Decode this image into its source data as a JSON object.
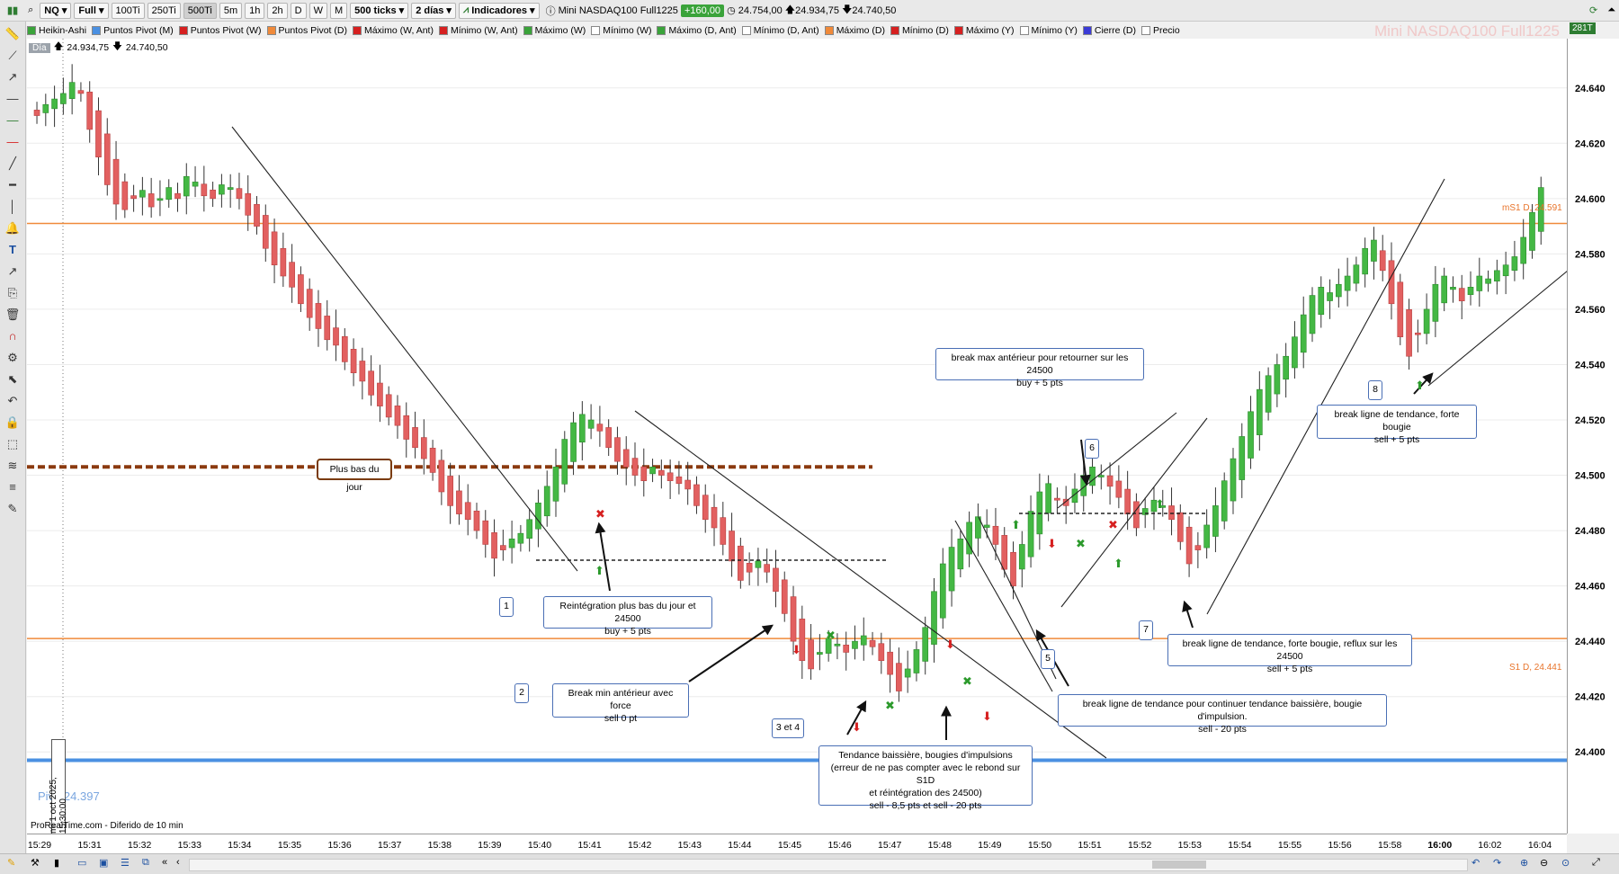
{
  "toolbar": {
    "symbol": "NQ",
    "view": "Full",
    "tf_100": "100Ti",
    "tf_250": "250Ti",
    "tf_500": "500Ti",
    "tf_5m": "5m",
    "tf_1h": "1h",
    "tf_2h": "2h",
    "tf_d": "D",
    "tf_w": "W",
    "tf_m": "M",
    "ticks": "500 ticks",
    "period": "2 días",
    "indicators": "Indicadores",
    "instrument": "Mini NASDAQ100 Full1225",
    "change": "+160,00",
    "last": "24.754,00",
    "high": "24.934,75",
    "low": "24.740,50"
  },
  "legend": {
    "items": [
      {
        "label": "Heikin-Ashi",
        "color": "#3aa33a"
      },
      {
        "label": "Puntos Pivot (M)",
        "color": "#4a90e2"
      },
      {
        "label": "Puntos Pivot (W)",
        "color": "#d62020"
      },
      {
        "label": "Puntos Pivot (D)",
        "color": "#f08a3a"
      },
      {
        "label": "Máximo (W, Ant)",
        "color": "#d62020"
      },
      {
        "label": "Mínimo (W, Ant)",
        "color": "#d62020"
      },
      {
        "label": "Máximo (W)",
        "color": "#3aa33a"
      },
      {
        "label": "Mínimo (W)",
        "color": "#ffffff"
      },
      {
        "label": "Máximo (D, Ant)",
        "color": "#3aa33a"
      },
      {
        "label": "Mínimo (D, Ant)",
        "color": "#ffffff"
      },
      {
        "label": "Máximo (D)",
        "color": "#f08a3a"
      },
      {
        "label": "Mínimo (D)",
        "color": "#d62020"
      },
      {
        "label": "Máximo (Y)",
        "color": "#d62020"
      },
      {
        "label": "Mínimo (Y)",
        "color": "#ffffff"
      },
      {
        "label": "Cierre (D)",
        "color": "#3b3bd6"
      },
      {
        "label": "Precio",
        "color": "#ffffff"
      }
    ]
  },
  "header": {
    "day_badge": "Día",
    "day_high": "24.934,75",
    "day_low": "24.740,50"
  },
  "watermark": "Mini NASDAQ100 Full1225",
  "tick_badge": "281T",
  "footer": {
    "source": "ProRealTime.com - Diferido de 10 min",
    "date_marker": "mi 1 oct 2025, 15:30:00"
  },
  "levels": {
    "ms1_label": "mS1 D, 24.591",
    "s1_label": "S1 D, 24.441",
    "piv_label": "Piv",
    "piv_value": "24.397"
  },
  "annotations": {
    "plus_bas": "Plus bas du jour",
    "a1_line1": "Reintégration plus bas du jour et 24500",
    "a1_line2": "buy + 5 pts",
    "a2_line1": "Break min antérieur avec force",
    "a2_line2": "sell 0 pt",
    "a34_line1": "Tendance baissière, bougies d'impulsions",
    "a34_line2": "(erreur de ne pas compter avec le rebond sur S1D",
    "a34_line3": "et réintégration des 24500)",
    "a34_line4": "sell - 8,5 pts et sell - 20 pts",
    "a5_line1": "break ligne de tendance pour continuer tendance baissière, bougie d'impulsion.",
    "a5_line2": "sell - 20 pts",
    "a6_line1": "break max antérieur pour retourner sur les 24500",
    "a6_line2": "buy + 5 pts",
    "a7_line1": "break ligne de tendance, forte bougie, reflux sur les 24500",
    "a7_line2": "sell + 5 pts",
    "a8_line1": "break ligne de tendance, forte bougie",
    "a8_line2": "sell + 5 pts",
    "n1": "1",
    "n2": "2",
    "n34": "3 et 4",
    "n5": "5",
    "n6": "6",
    "n7": "7",
    "n8": "8"
  },
  "chart_data": {
    "type": "candlestick",
    "style": "Heikin-Ashi",
    "ylim": [
      24390,
      24650
    ],
    "y_ticks": [
      "24.640",
      "24.620",
      "24.600",
      "24.580",
      "24.560",
      "24.540",
      "24.520",
      "24.500",
      "24.480",
      "24.460",
      "24.440",
      "24.420",
      "24.400"
    ],
    "x_ticks": [
      "15:29",
      "15:31",
      "15:32",
      "15:33",
      "15:34",
      "15:35",
      "15:36",
      "15:37",
      "15:38",
      "15:39",
      "15:40",
      "15:41",
      "15:42",
      "15:43",
      "15:44",
      "15:45",
      "15:46",
      "15:47",
      "15:48",
      "15:49",
      "15:50",
      "15:51",
      "15:52",
      "15:53",
      "15:54",
      "15:55",
      "15:56",
      "15:58",
      "16:00",
      "16:02",
      "16:04"
    ],
    "levels": [
      {
        "name": "mS1 D",
        "value": 24591,
        "color": "#f08a3a"
      },
      {
        "name": "S1 D",
        "value": 24441,
        "color": "#f08a3a"
      },
      {
        "name": "Piv",
        "value": 24397,
        "color": "#4a90e2"
      },
      {
        "name": "Plus bas du jour",
        "value": 24503,
        "color": "#8b3a0f"
      }
    ],
    "closes": [
      24630,
      24634,
      24636,
      24638,
      24642,
      24638,
      24625,
      24615,
      24605,
      24598,
      24596,
      24600,
      24603,
      24597,
      24600,
      24604,
      24600,
      24608,
      24606,
      24601,
      24600,
      24605,
      24604,
      24600,
      24594,
      24590,
      24582,
      24576,
      24572,
      24568,
      24562,
      24557,
      24553,
      24549,
      24547,
      24541,
      24537,
      24534,
      24529,
      24525,
      24521,
      24518,
      24513,
      24510,
      24506,
      24501,
      24494,
      24489,
      24486,
      24484,
      24480,
      24475,
      24470,
      24473,
      24477,
      24479,
      24484,
      24490,
      24496,
      24503,
      24513,
      24519,
      24522,
      24520,
      24516,
      24510,
      24505,
      24503,
      24500,
      24498,
      24503,
      24500,
      24498,
      24497,
      24495,
      24489,
      24484,
      24481,
      24475,
      24469,
      24462,
      24465,
      24469,
      24465,
      24458,
      24450,
      24440,
      24433,
      24430,
      24436,
      24441,
      24439,
      24436,
      24440,
      24442,
      24438,
      24433,
      24428,
      24422,
      24430,
      24437,
      24445,
      24458,
      24468,
      24474,
      24477,
      24483,
      24485,
      24482,
      24475,
      24466,
      24460,
      24475,
      24487,
      24494,
      24497,
      24491,
      24489,
      24495,
      24500,
      24503,
      24500,
      24496,
      24492,
      24486,
      24481,
      24488,
      24491,
      24489,
      24484,
      24476,
      24468,
      24473,
      24482,
      24489,
      24498,
      24506,
      24514,
      24523,
      24531,
      24536,
      24540,
      24543,
      24550,
      24558,
      24565,
      24568,
      24566,
      24569,
      24572,
      24576,
      24582,
      24585,
      24574,
      24562,
      24550,
      24543,
      24551,
      24560,
      24569,
      24572,
      24568,
      24563,
      24568,
      24572,
      24571,
      24574,
      24576,
      24579,
      24586,
      24595,
      24604
    ]
  }
}
